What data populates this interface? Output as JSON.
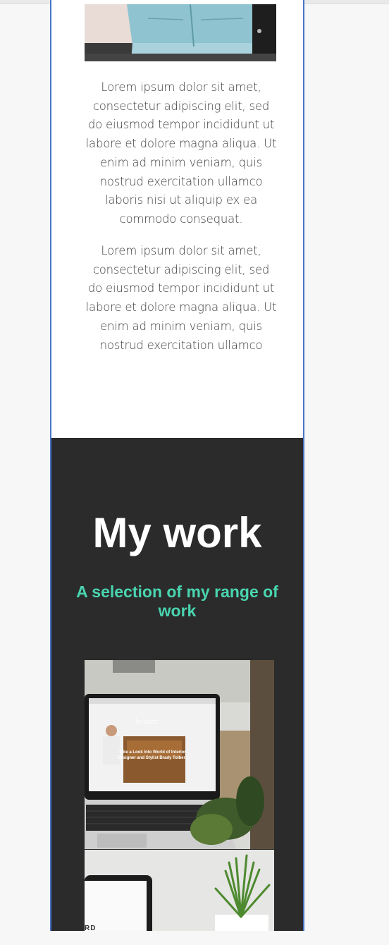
{
  "paragraphs": [
    "Lorem ipsum dolor sit amet, consectetur adipiscing elit, sed do eiusmod tempor incididunt ut labore et dolore magna aliqua. Ut enim ad minim veniam, quis nostrud exercitation ullamco laboris nisi ut aliquip ex ea commodo consequat.",
    "Lorem ipsum dolor sit amet, consectetur adipiscing elit, sed do eiusmod tempor incididunt ut labore et dolore magna aliqua. Ut enim ad minim veniam, quis nostrud exercitation ullamco"
  ],
  "work": {
    "title": "My work",
    "subtitle": "A selection of my range of work",
    "screen_caption_line1": "Take a Look Into World of Interior",
    "screen_caption_line2": "Designer and Stylist Brady Tolbert",
    "screen_logo": "le buzz",
    "corner_text": "RD"
  },
  "colors": {
    "accent": "#49d5b0",
    "dark_section": "#2b2b2b",
    "frame_border": "#4a74c9"
  }
}
